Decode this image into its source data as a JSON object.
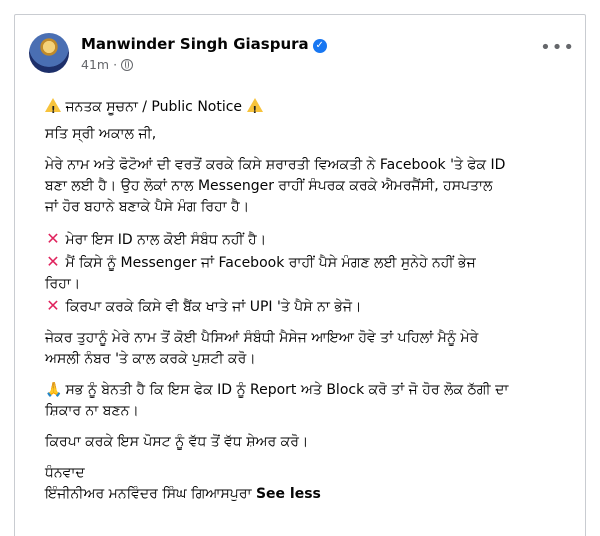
{
  "post": {
    "author": "Manwinder Singh Giaspura",
    "time": "41m",
    "separator": "·",
    "title_prefix_icon": "warning-icon",
    "title": "ਜਨਤਕ ਸੂਚਨਾ / Public Notice",
    "greeting": "ਸਤਿ ਸ੍ਰੀ ਅਕਾਲ ਜੀ,",
    "para1": [
      "ਮੇਰੇ ਨਾਮ ਅਤੇ ਫੋਟੋਆਂ ਦੀ ਵਰਤੋਂ ਕਰਕੇ ਕਿਸੇ ਸ਼ਰਾਰਤੀ ਵਿਅਕਤੀ ਨੇ Facebook 'ਤੇ ਫੇਕ ID",
      "ਬਣਾ ਲਈ ਹੈ। ਉਹ ਲੋਕਾਂ ਨਾਲ Messenger ਰਾਹੀਂ ਸੰਪਰਕ ਕਰਕੇ ਐਮਰਜੈਂਸੀ, ਹਸਪਤਾਲ",
      "ਜਾਂ ਹੋਰ ਬਹਾਨੇ ਬਣਾਕੇ ਪੈਸੇ ਮੰਗ ਰਿਹਾ ਹੈ।"
    ],
    "points": [
      [
        "ਮੇਰਾ ਇਸ ID ਨਾਲ ਕੋਈ ਸੰਬੰਧ ਨਹੀਂ ਹੈ।"
      ],
      [
        "ਮੈਂ ਕਿਸੇ ਨੂੰ Messenger ਜਾਂ Facebook ਰਾਹੀਂ ਪੈਸੇ ਮੰਗਣ ਲਈ ਸੁਨੇਹੇ ਨਹੀਂ ਭੇਜ",
        "ਰਿਹਾ।"
      ],
      [
        "ਕਿਰਪਾ ਕਰਕੇ ਕਿਸੇ ਵੀ ਬੈਂਕ ਖਾਤੇ ਜਾਂ UPI 'ਤੇ ਪੈਸੇ ਨਾ ਭੇਜੋ।"
      ]
    ],
    "para2": [
      "ਜੇਕਰ ਤੁਹਾਨੂੰ ਮੇਰੇ ਨਾਮ ਤੋਂ ਕੋਈ ਪੈਸਿਆਂ ਸੰਬੰਧੀ ਮੈਸੇਜ ਆਇਆ ਹੋਵੇ ਤਾਂ ਪਹਿਲਾਂ ਮੈਨੂੰ ਮੇਰੇ",
      "ਅਸਲੀ ਨੰਬਰ 'ਤੇ ਕਾਲ ਕਰਕੇ ਪੁਸ਼ਟੀ ਕਰੋ।"
    ],
    "para3": [
      "ਸਭ ਨੂੰ ਬੇਨਤੀ ਹੈ ਕਿ ਇਸ ਫੇਕ ID ਨੂੰ Report ਅਤੇ Block ਕਰੋ ਤਾਂ ਜੋ ਹੋਰ ਲੋਕ ਠੱਗੀ ਦਾ",
      "ਸ਼ਿਕਾਰ ਨਾ ਬਣਨ।"
    ],
    "para4": "ਕਿਰਪਾ ਕਰਕੇ ਇਸ ਪੋਸਟ ਨੂੰ ਵੱਧ ਤੋਂ ਵੱਧ ਸ਼ੇਅਰ ਕਰੋ।",
    "thanks": "ਧੰਨਵਾਦ",
    "signature": "ਇੰਜੀਨੀਅਰ ਮਨਵਿੰਦਰ ਸਿੰਘ ਗਿਆਸਪੁਰਾ",
    "see_less": "See less"
  }
}
